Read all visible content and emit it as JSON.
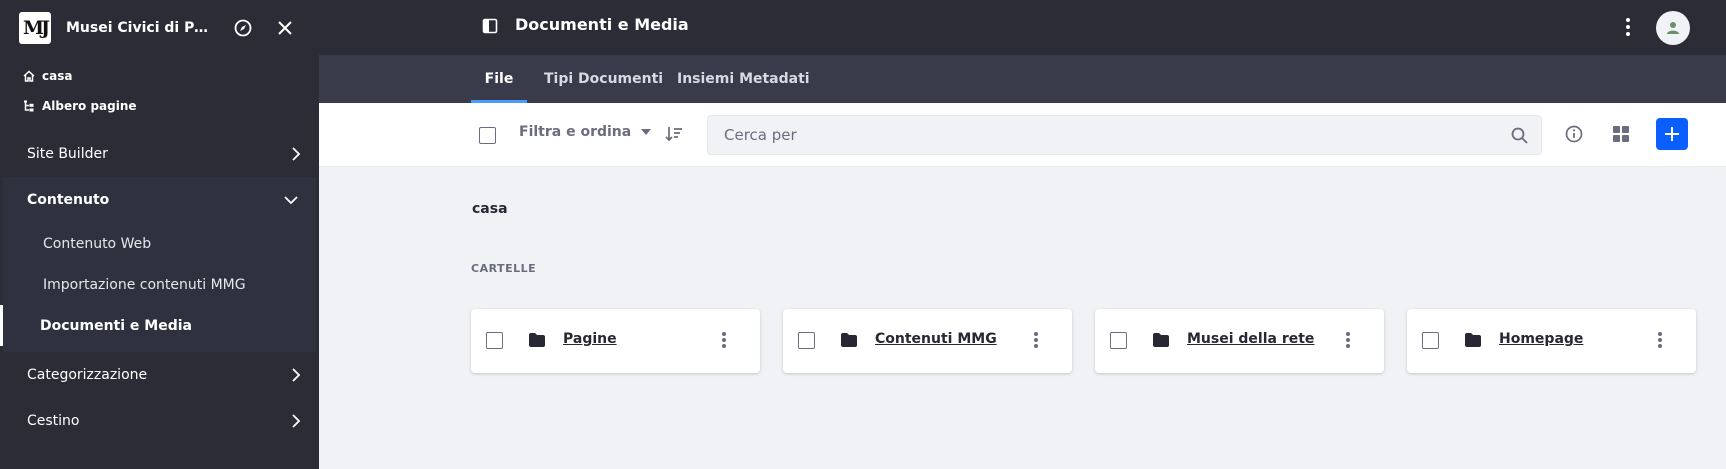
{
  "sidebar": {
    "site_logo_text": "MJ",
    "site_name": "Musei Civici di Palazzo",
    "quick_links": [
      {
        "label": "casa",
        "icon": "home-icon"
      },
      {
        "label": "Albero pagine",
        "icon": "page-tree-icon"
      }
    ],
    "sections": [
      {
        "label": "Site Builder"
      },
      {
        "label": "Contenuto"
      },
      {
        "label": "Categorizzazione"
      },
      {
        "label": "Cestino"
      }
    ],
    "content_items": [
      {
        "label": "Contenuto Web"
      },
      {
        "label": "Importazione contenuti MMG"
      },
      {
        "label": "Documenti e Media"
      }
    ]
  },
  "header": {
    "title": "Documenti e Media"
  },
  "tabs": [
    {
      "label": "File"
    },
    {
      "label": "Tipi Documenti"
    },
    {
      "label": "Insiemi Metadati"
    }
  ],
  "toolbar": {
    "filter_label": "Filtra e ordina",
    "search_placeholder": "Cerca per"
  },
  "main": {
    "breadcrumb": "casa",
    "folders_heading": "CARTELLE",
    "folders": [
      {
        "name": "Pagine"
      },
      {
        "name": "Contenuti MMG"
      },
      {
        "name": "Musei della rete"
      },
      {
        "name": "Homepage"
      }
    ]
  },
  "colors": {
    "sidebar_bg": "#2b2c36",
    "navbar_bg": "#393a4a",
    "primary": "#0b5fff",
    "active_tab_underline": "#4b9bff",
    "page_bg": "#f1f2f5"
  }
}
